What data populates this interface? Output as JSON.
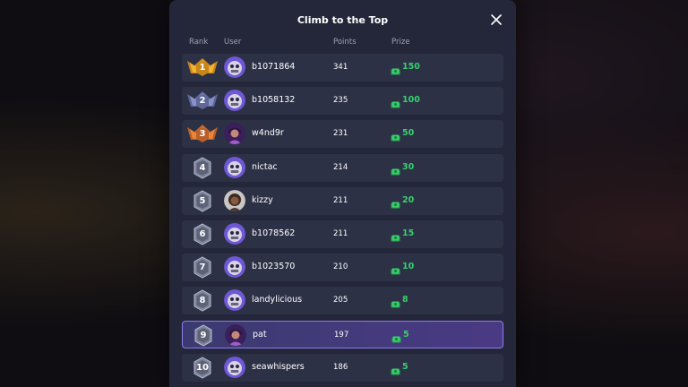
{
  "modal": {
    "title": "Climb to the Top",
    "headers": {
      "rank": "Rank",
      "user": "User",
      "points": "Points",
      "prize": "Prize"
    }
  },
  "rows": [
    {
      "rank": "1",
      "user": "b1071864",
      "points": "341",
      "prize": "150",
      "badge": "gold-crown",
      "avatar": "robot"
    },
    {
      "rank": "2",
      "user": "b1058132",
      "points": "235",
      "prize": "100",
      "badge": "silver-crown",
      "avatar": "robot"
    },
    {
      "rank": "3",
      "user": "w4nd9r",
      "points": "231",
      "prize": "50",
      "badge": "bronze-crown",
      "avatar": "person"
    },
    {
      "rank": "4",
      "user": "nictac",
      "points": "214",
      "prize": "30",
      "badge": "hex",
      "avatar": "robot"
    },
    {
      "rank": "5",
      "user": "kizzy",
      "points": "211",
      "prize": "20",
      "badge": "hex",
      "avatar": "woman"
    },
    {
      "rank": "6",
      "user": "b1078562",
      "points": "211",
      "prize": "15",
      "badge": "hex",
      "avatar": "robot"
    },
    {
      "rank": "7",
      "user": "b1023570",
      "points": "210",
      "prize": "10",
      "badge": "hex",
      "avatar": "robot"
    },
    {
      "rank": "8",
      "user": "landylicious",
      "points": "205",
      "prize": "8",
      "badge": "hex",
      "avatar": "robot"
    },
    {
      "rank": "9",
      "user": "pat",
      "points": "197",
      "prize": "5",
      "badge": "hex",
      "avatar": "person",
      "highlight": true
    },
    {
      "rank": "10",
      "user": "seawhispers",
      "points": "186",
      "prize": "5",
      "badge": "hex",
      "avatar": "robot"
    }
  ],
  "colors": {
    "gold": "#f2b233",
    "silver": "#8a93c8",
    "bronze": "#e8863a",
    "hex": "#7f859b",
    "prize": "#35d06b",
    "highlight_border": "#8f79e8"
  },
  "icons": {
    "close": "close-icon",
    "prize": "money-icon"
  }
}
